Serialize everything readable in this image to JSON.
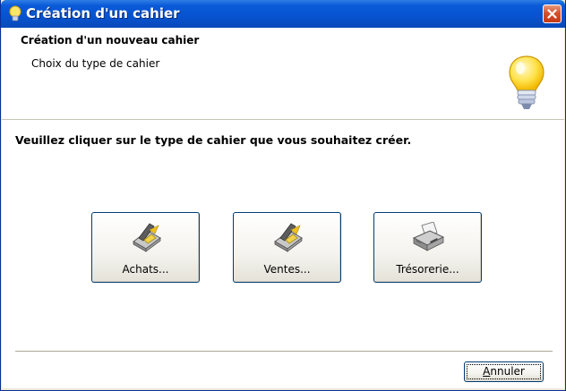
{
  "window": {
    "title": "Création d'un cahier",
    "title_icon": "lightbulb-icon",
    "close_icon": "close-icon"
  },
  "header": {
    "title": "Création d'un nouveau cahier",
    "subtitle": "Choix du type de cahier",
    "icon": "lightbulb-icon"
  },
  "instruction": "Veuillez cliquer sur le type de cahier que vous souhaitez créer.",
  "buttons": [
    {
      "label": "Achats...",
      "icon": "purchases-scanner-icon"
    },
    {
      "label": "Ventes...",
      "icon": "sales-scanner-icon"
    },
    {
      "label": "Trésorerie...",
      "icon": "treasury-printer-icon"
    }
  ],
  "footer": {
    "cancel_label_first": "A",
    "cancel_label_rest": "nnuler"
  },
  "colors": {
    "titlebar": "#0653d0",
    "close": "#d3512e",
    "button_border": "#003c74",
    "dialog_bg": "#ffffff"
  }
}
